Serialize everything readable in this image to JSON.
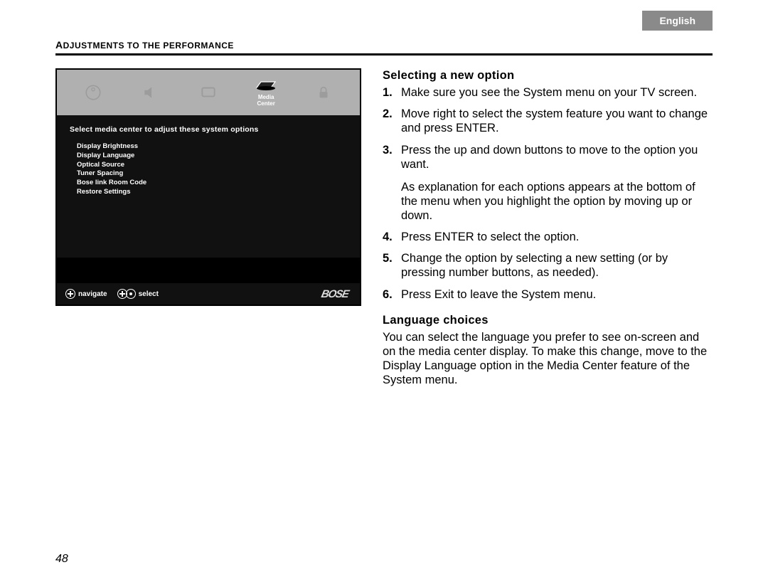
{
  "language_tab": "English",
  "section_header": "Adjustments to the performance",
  "page_number": "48",
  "tv": {
    "media_center_label": "Media\nCenter",
    "instruction": "Select media center to adjust these system options",
    "options": [
      "Display Brightness",
      "Display Language",
      "Optical Source",
      "Tuner Spacing",
      "Bose link Room Code",
      "Restore Settings"
    ],
    "footer_navigate": "navigate",
    "footer_select": "select",
    "brand": "BOSE"
  },
  "right": {
    "heading1": "Selecting a new option",
    "steps": [
      {
        "n": "1.",
        "t": "Make sure you see the System menu on your TV screen."
      },
      {
        "n": "2.",
        "t": "Move right to select the system feature you want to change and press ENTER."
      },
      {
        "n": "3.",
        "t": "Press the up and down buttons to move to the option you want."
      }
    ],
    "step3_extra": "As explanation for each options appears at the bottom of the menu when you highlight the option by moving up or down.",
    "steps_cont": [
      {
        "n": "4.",
        "t": "Press ENTER to select the option."
      },
      {
        "n": "5.",
        "t": "Change the option by selecting a new setting (or by pressing number buttons, as needed)."
      },
      {
        "n": "6.",
        "t": "Press Exit to leave the System menu."
      }
    ],
    "heading2": "Language choices",
    "lang_para": "You can select the language you prefer to see on-screen and on the media center display. To make this change, move to the Display Language option in the Media Center feature of the System menu."
  }
}
